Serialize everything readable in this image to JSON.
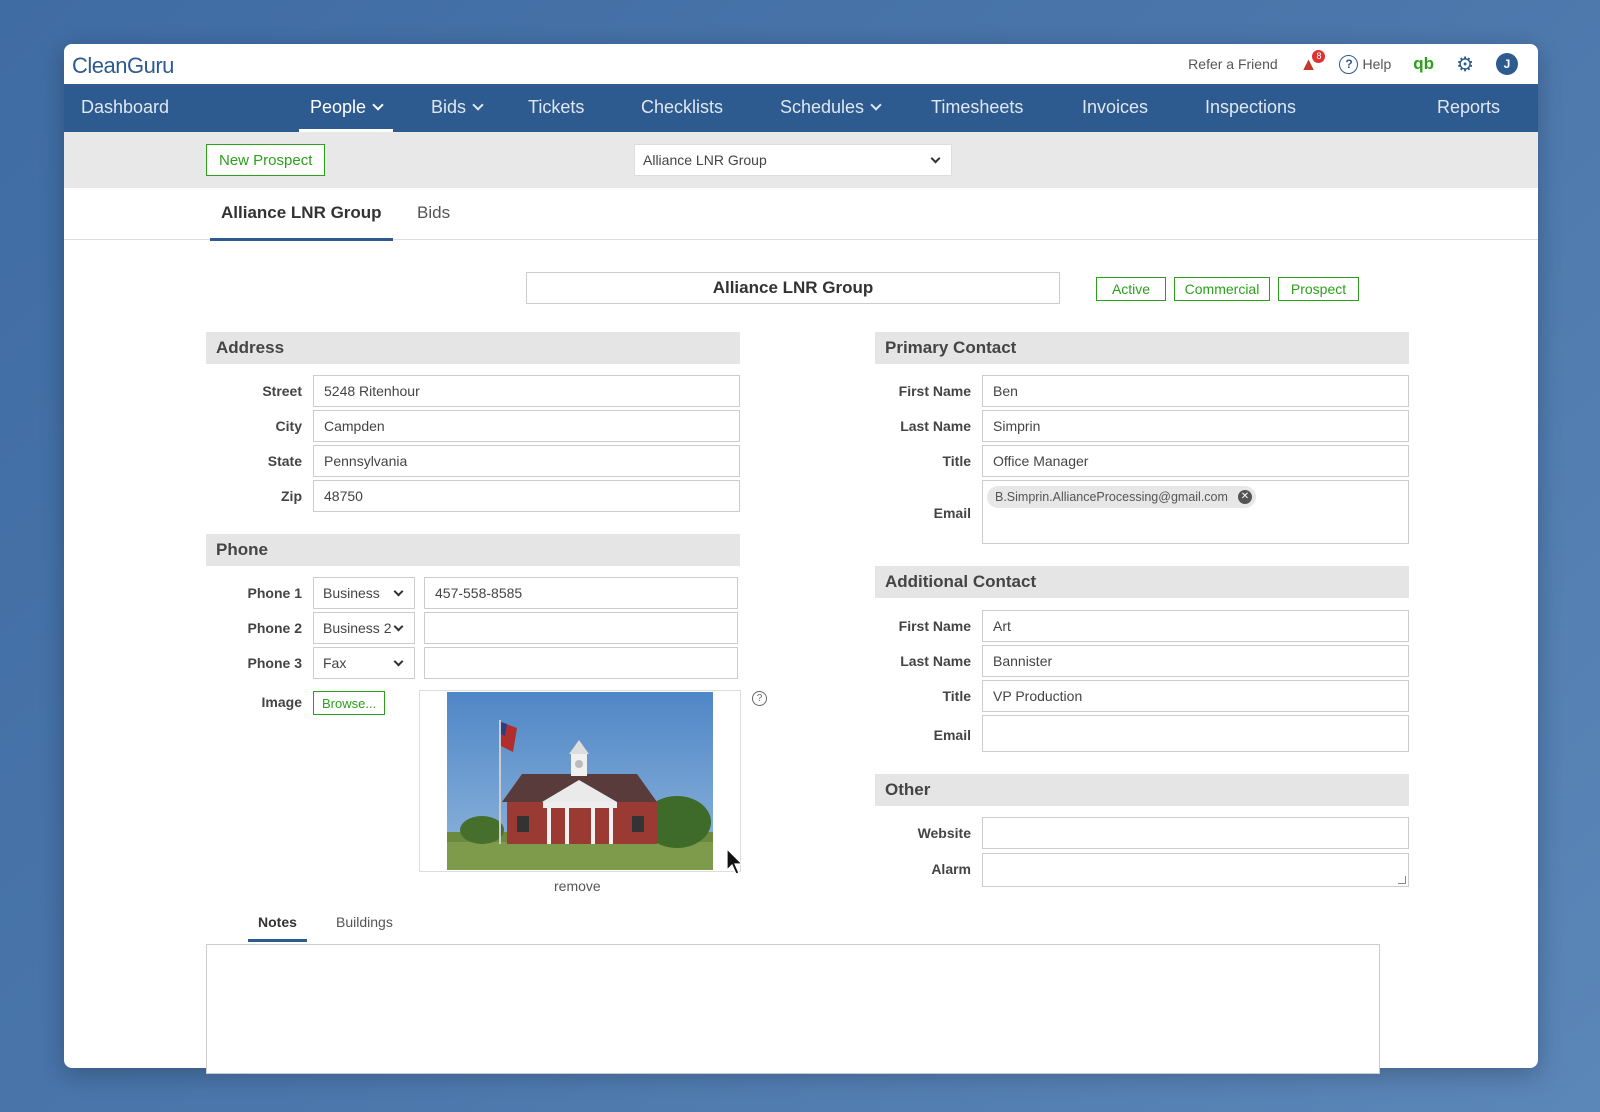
{
  "app": {
    "logo": "CleanGuru"
  },
  "topbar": {
    "refer": "Refer a Friend",
    "notif_count": "8",
    "help": "Help",
    "qb": "qb",
    "avatar": "J"
  },
  "nav": {
    "dashboard": "Dashboard",
    "people": "People",
    "bids": "Bids",
    "tickets": "Tickets",
    "checklists": "Checklists",
    "schedules": "Schedules",
    "timesheets": "Timesheets",
    "invoices": "Invoices",
    "inspections": "Inspections",
    "reports": "Reports"
  },
  "toolbar": {
    "new_prospect": "New Prospect",
    "company_select": "Alliance LNR Group"
  },
  "tabs": {
    "company": "Alliance LNR Group",
    "bids": "Bids"
  },
  "company": {
    "name": "Alliance LNR Group",
    "tags": [
      "Active",
      "Commercial",
      "Prospect"
    ]
  },
  "address": {
    "heading": "Address",
    "street_label": "Street",
    "street": "5248 Ritenhour",
    "city_label": "City",
    "city": "Campden",
    "state_label": "State",
    "state": "Pennsylvania",
    "zip_label": "Zip",
    "zip": "48750"
  },
  "phone": {
    "heading": "Phone",
    "p1_label": "Phone 1",
    "p1_type": "Business",
    "p1_number": "457-558-8585",
    "p2_label": "Phone 2",
    "p2_type": "Business 2",
    "p2_number": "",
    "p3_label": "Phone 3",
    "p3_type": "Fax",
    "p3_number": "",
    "image_label": "Image",
    "browse": "Browse...",
    "remove": "remove"
  },
  "primary": {
    "heading": "Primary Contact",
    "first_label": "First Name",
    "first": "Ben",
    "last_label": "Last Name",
    "last": "Simprin",
    "title_label": "Title",
    "title": "Office Manager",
    "email_label": "Email",
    "email": "B.Simprin.AllianceProcessing@gmail.com"
  },
  "additional": {
    "heading": "Additional Contact",
    "first_label": "First Name",
    "first": "Art",
    "last_label": "Last Name",
    "last": "Bannister",
    "title_label": "Title",
    "title": "VP Production",
    "email_label": "Email",
    "email": ""
  },
  "other": {
    "heading": "Other",
    "website_label": "Website",
    "website": "",
    "alarm_label": "Alarm",
    "alarm": ""
  },
  "bottom_tabs": {
    "notes": "Notes",
    "buildings": "Buildings"
  },
  "colors": {
    "nav": "#2d5a8f",
    "accent_green": "#2ca01c"
  }
}
